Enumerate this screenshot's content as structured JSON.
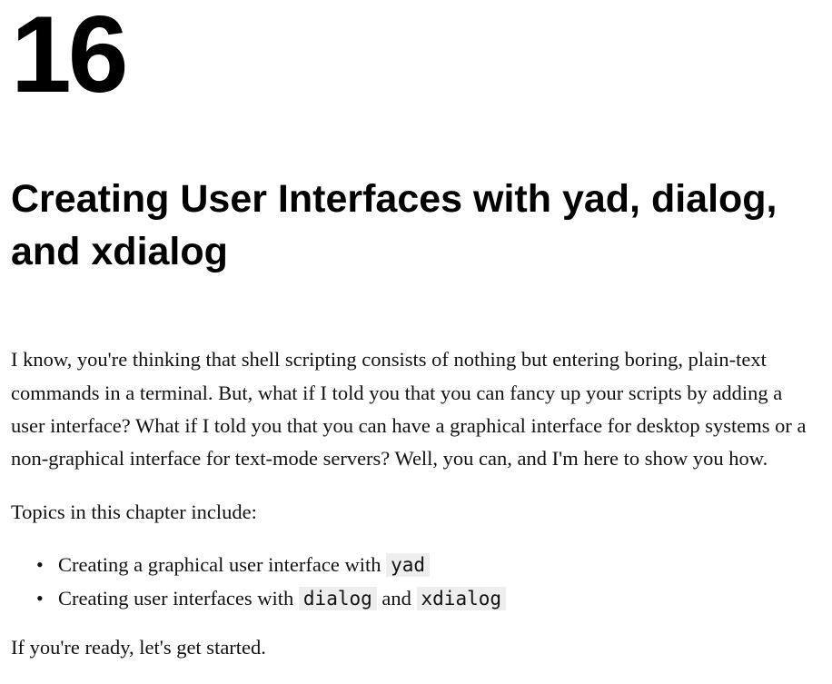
{
  "chapter": {
    "number": "16",
    "title": "Creating User Interfaces with yad, dialog, and xdialog"
  },
  "intro_paragraph": "I know, you're thinking that shell scripting consists of nothing but entering boring, plain-text commands in a terminal. But, what if I told you that you can fancy up your scripts by adding a user interface? What if I told you that you can have a graphical interface for desktop systems or a non-graphical interface for text-mode servers? Well, you can, and I'm here to show you how.",
  "topics_intro": "Topics in this chapter include:",
  "topics": [
    {
      "prefix": "Creating a graphical user interface with ",
      "code1": "yad",
      "middle": "",
      "code2": "",
      "suffix": ""
    },
    {
      "prefix": "Creating user interfaces with ",
      "code1": "dialog",
      "middle": " and ",
      "code2": "xdialog",
      "suffix": ""
    }
  ],
  "closing": "If you're ready, let's get started."
}
